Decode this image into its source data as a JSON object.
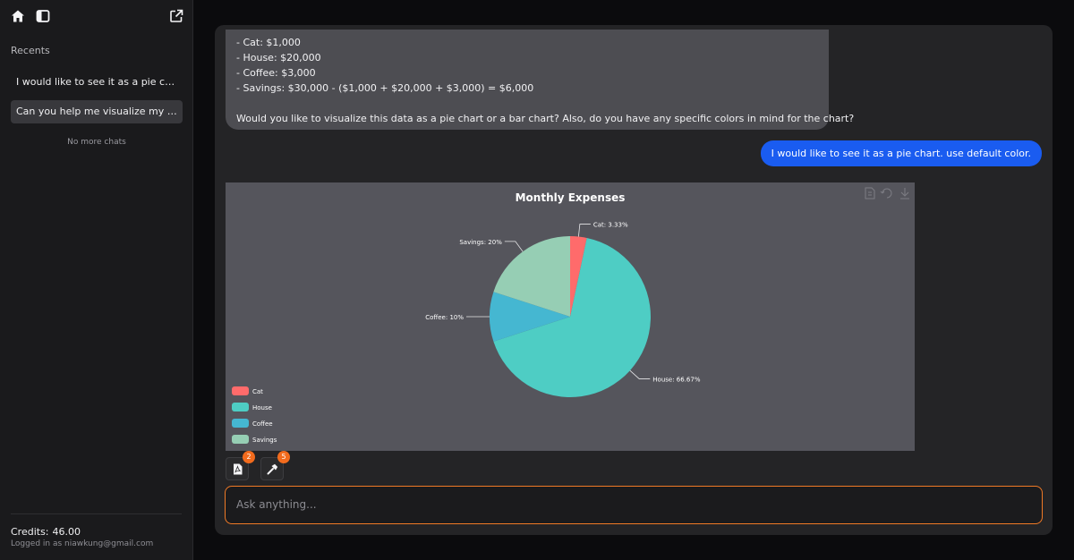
{
  "sidebar": {
    "recents_title": "Recents",
    "chats": [
      {
        "label": "I would like to see it as a pie cha..."
      },
      {
        "label": "Can you help me visualize my ex..."
      }
    ],
    "no_more_label": "No more chats",
    "credits_label": "Credits:",
    "credits_value": "46.00",
    "logged_in": "Logged in as niawkung@gmail.com",
    "icons": [
      "home-icon",
      "sidebar-toggle-icon",
      "new-chat-icon"
    ]
  },
  "conversation": {
    "assistant_lines": [
      "- Cat: $1,000",
      "- House: $20,000",
      "- Coffee: $3,000",
      "- Savings: $30,000 - ($1,000 + $20,000 + $3,000) = $6,000",
      "",
      "Would you like to visualize this data as a pie chart or a bar chart? Also, do you have any specific colors in mind for the chart?"
    ],
    "user_message": "I would like to see it as a pie chart. use default color."
  },
  "chart_data": {
    "type": "pie",
    "title": "Monthly Expenses",
    "categories": [
      "Cat",
      "House",
      "Coffee",
      "Savings"
    ],
    "values": [
      3.33,
      66.67,
      10,
      20
    ],
    "slice_labels": [
      "Cat: 3.33%",
      "House: 66.67%",
      "Coffee: 10%",
      "Savings: 20%"
    ],
    "colors": [
      "#ff6b6b",
      "#4ecdc4",
      "#45b7d1",
      "#96ceb4"
    ],
    "legend": "bottom-left",
    "toolbar_icons": [
      "data-view-icon",
      "restore-icon",
      "download-icon"
    ]
  },
  "tools": [
    {
      "icon": "pdf-file-icon",
      "count": "2"
    },
    {
      "icon": "hammer-icon",
      "count": "5"
    }
  ],
  "input": {
    "placeholder": "Ask anything..."
  },
  "colors": {
    "accent": "#1a5cf0",
    "input_border": "#f07a26",
    "badge": "#f26b1d"
  }
}
